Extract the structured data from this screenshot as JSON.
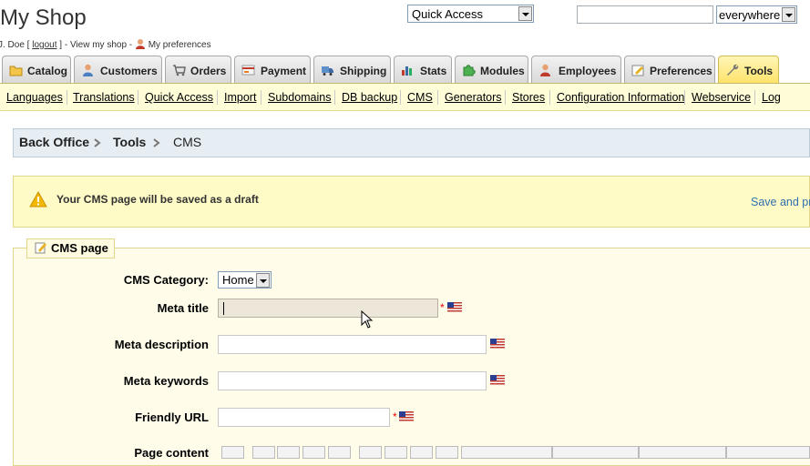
{
  "header": {
    "shop_title": "My Shop",
    "user_name": "J. Doe [",
    "logout_label": "logout",
    "user_suffix": "] - View my shop -",
    "preferences_label": "My preferences",
    "quick_access_value": "Quick Access",
    "search_value": "",
    "search_scope_value": "everywhere"
  },
  "tabs": [
    {
      "label": "Catalog",
      "icon": "folder-icon"
    },
    {
      "label": "Customers",
      "icon": "customer-icon"
    },
    {
      "label": "Orders",
      "icon": "cart-icon"
    },
    {
      "label": "Payment",
      "icon": "payment-icon"
    },
    {
      "label": "Shipping",
      "icon": "truck-icon"
    },
    {
      "label": "Stats",
      "icon": "stats-icon"
    },
    {
      "label": "Modules",
      "icon": "puzzle-icon"
    },
    {
      "label": "Employees",
      "icon": "employee-icon"
    },
    {
      "label": "Preferences",
      "icon": "preferences-icon"
    },
    {
      "label": "Tools",
      "icon": "wrench-icon",
      "active": true
    }
  ],
  "subtabs": [
    "Languages",
    "Translations",
    "Quick Access",
    "Import",
    "Subdomains",
    "DB backup",
    "CMS",
    "Generators",
    "Stores",
    "Configuration Information",
    "Webservice",
    "Log"
  ],
  "breadcrumb": [
    "Back Office",
    "Tools",
    "CMS"
  ],
  "warning": {
    "message": "Your CMS page will be saved as a draft",
    "action_label": "Save and pr"
  },
  "form": {
    "legend": "CMS page",
    "category_label": "CMS Category:",
    "category_value": "Home",
    "meta_title_label": "Meta title",
    "meta_title_value": "",
    "meta_description_label": "Meta description",
    "meta_description_value": "",
    "meta_keywords_label": "Meta keywords",
    "meta_keywords_value": "",
    "friendly_url_label": "Friendly URL",
    "friendly_url_value": "",
    "page_content_label": "Page content",
    "required_marker": "*"
  },
  "colors": {
    "accent_tab": "#ffe36a",
    "subtab_bg": "#fffcd8",
    "warning_bg": "#fffbc6",
    "link": "#2f6fb0",
    "required": "#ee0000"
  }
}
